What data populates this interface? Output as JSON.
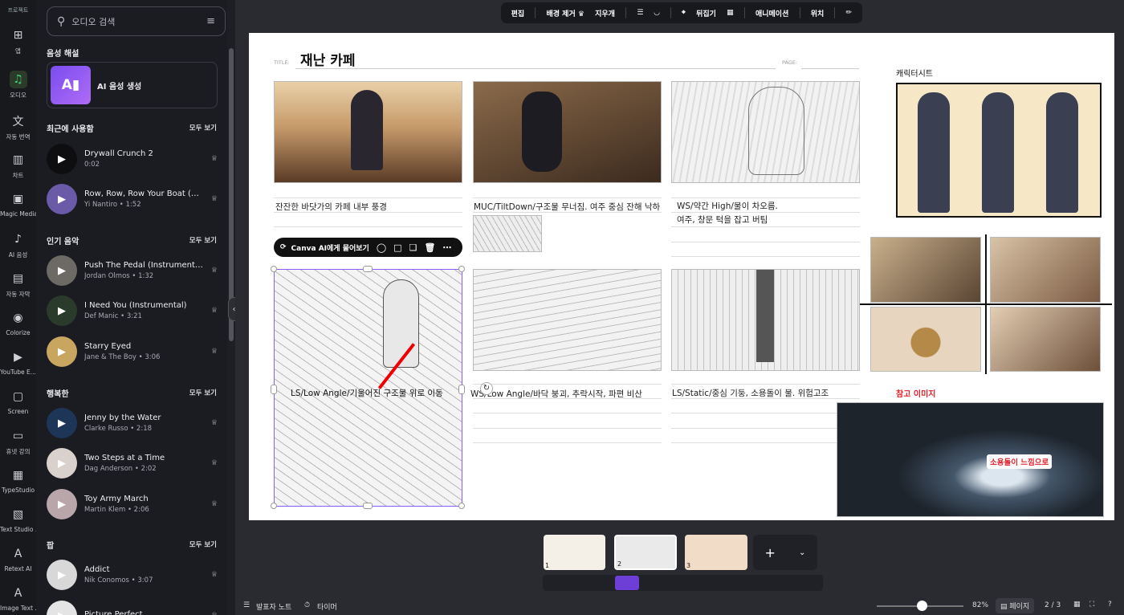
{
  "rail": {
    "top_label": "프로젝트",
    "items": [
      {
        "label": "앱",
        "icon": "apps-icon",
        "active": false
      },
      {
        "label": "오디오",
        "icon": "music-note-icon",
        "active": true
      },
      {
        "label": "자동 번역",
        "icon": "translate-icon",
        "active": false
      },
      {
        "label": "차트",
        "icon": "chart-icon",
        "active": false
      },
      {
        "label": "Magic Media",
        "icon": "magic-media-icon",
        "active": false
      },
      {
        "label": "AI 음성",
        "icon": "ai-voice-icon",
        "active": false
      },
      {
        "label": "자동 자막",
        "icon": "captions-icon",
        "active": false
      },
      {
        "label": "Colorize",
        "icon": "colorize-icon",
        "active": false
      },
      {
        "label": "YouTube E...",
        "icon": "youtube-icon",
        "active": false
      },
      {
        "label": "Screen",
        "icon": "screen-icon",
        "active": false
      },
      {
        "label": "휴넷 강의",
        "icon": "lecture-icon",
        "active": false
      },
      {
        "label": "TypeStudio",
        "icon": "typestudio-icon",
        "active": false
      },
      {
        "label": "Text Studio ...",
        "icon": "text-studio-icon",
        "active": false
      },
      {
        "label": "Retext AI",
        "icon": "retext-icon",
        "active": false
      },
      {
        "label": "Image Text ...",
        "icon": "image-text-icon",
        "active": false
      }
    ]
  },
  "panel": {
    "search_placeholder": "오디오 검색",
    "voice_section": "음성 해설",
    "ai_voice_label": "AI 음성 생성",
    "see_all": "모두 보기",
    "sections": [
      {
        "title": "최근에 사용함",
        "tracks": [
          {
            "title": "Drywall Crunch 2",
            "sub": "0:02",
            "thumb": "#0e0e10"
          },
          {
            "title": "Row, Row, Row Your Boat (Harp Ve...",
            "sub": "Yi Nantiro • 1:52",
            "thumb": "#6b5aa8"
          }
        ]
      },
      {
        "title": "인기 음악",
        "tracks": [
          {
            "title": "Push The Pedal (Instrumental)",
            "sub": "Jordan Olmos • 1:32",
            "thumb": "#6d6a66"
          },
          {
            "title": "I Need You (Instrumental)",
            "sub": "Def Manic • 3:21",
            "thumb": "#2b3b2b"
          },
          {
            "title": "Starry Eyed",
            "sub": "Jane & The Boy • 3:06",
            "thumb": "#c9a660"
          }
        ]
      },
      {
        "title": "행복한",
        "tracks": [
          {
            "title": "Jenny by the Water",
            "sub": "Clarke Russo • 2:18",
            "thumb": "#1d3556"
          },
          {
            "title": "Two Steps at a Time",
            "sub": "Dag Anderson • 2:02",
            "thumb": "#d9d2cc"
          },
          {
            "title": "Toy Army March",
            "sub": "Martin Klem • 2:06",
            "thumb": "#b8a6aa"
          }
        ]
      },
      {
        "title": "팝",
        "tracks": [
          {
            "title": "Addict",
            "sub": "Nik Conomos • 3:07",
            "thumb": "#d8d8d8"
          },
          {
            "title": "Picture Perfect",
            "sub": "",
            "thumb": "#e4e4e4"
          }
        ]
      }
    ]
  },
  "toolbar": {
    "items": [
      "편집",
      "배경 제거 ♛",
      "지우개",
      "뒤집기",
      "애니메이션",
      "위치"
    ]
  },
  "storyboard": {
    "title_label": "TITLE:",
    "title": "재난 카페",
    "page_label": "PAGE:",
    "captions": [
      "잔잔한 바닷가의 카페 내부 풍경",
      "MUC/TiltDown/구조물 무너짐. 여주 중심 잔해 낙하",
      "WS/약간 High/물이 차오름.",
      "여주, 창문 턱을 잡고 버팀",
      "LS/Low Angle/기울어진 구조물 위로 이동",
      "WS/Low Angle/바닥 붕괴, 추락시작, 파편 비산",
      "LS/Static/중심 기둥, 소용돌이 물. 위험고조"
    ],
    "character_sheet": "캐릭터시트",
    "reference_title": "참고 이미지",
    "reference_note": "소용돌이 느낌으로"
  },
  "context_menu": {
    "ask_ai": "Canva AI에게 물어보기"
  },
  "bottom": {
    "notes": "발표자 노트",
    "timer": "타이머",
    "zoom": "82%",
    "pages_btn": "페이지",
    "page_counter": "2 / 3",
    "zoom_level": 0.52
  },
  "pages": [
    "1",
    "2",
    "3"
  ]
}
